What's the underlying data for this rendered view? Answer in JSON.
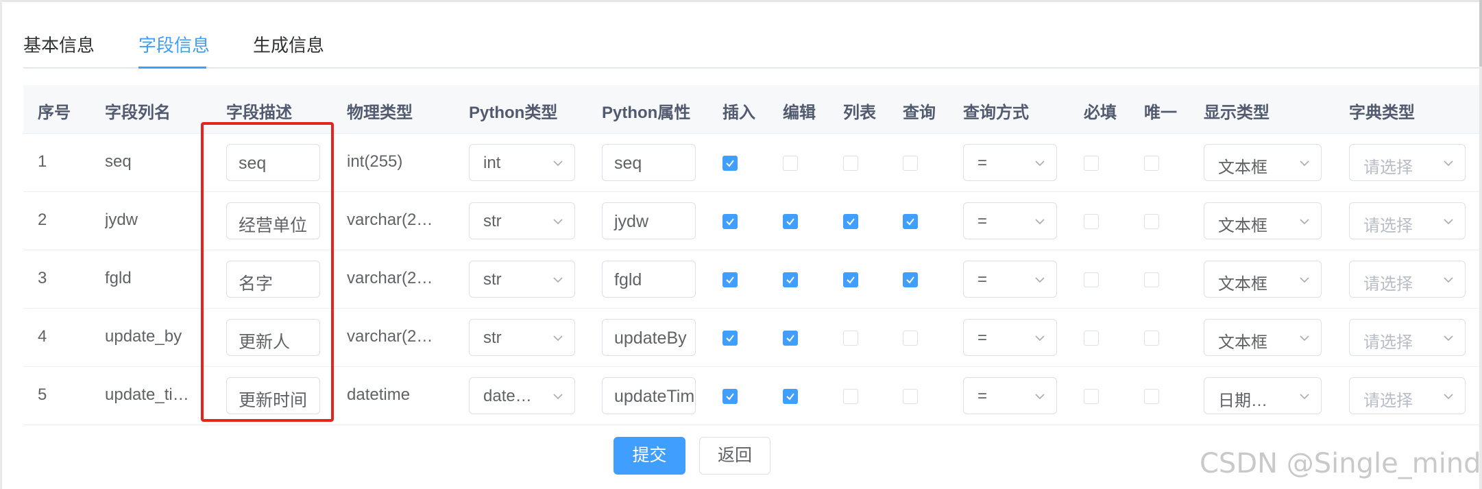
{
  "tabs": [
    {
      "label": "基本信息",
      "active": false
    },
    {
      "label": "字段信息",
      "active": true
    },
    {
      "label": "生成信息",
      "active": false
    }
  ],
  "table": {
    "columns": [
      "序号",
      "字段列名",
      "字段描述",
      "物理类型",
      "Python类型",
      "Python属性",
      "插入",
      "编辑",
      "列表",
      "查询",
      "查询方式",
      "必填",
      "唯一",
      "显示类型",
      "字典类型"
    ],
    "rows": [
      {
        "index": "1",
        "column_name": "seq",
        "description": "seq",
        "physical_type": "int(255)",
        "python_type": "int",
        "python_attr": "seq",
        "insert": true,
        "edit": false,
        "list": false,
        "query": false,
        "query_method": "=",
        "required": false,
        "unique": false,
        "display_type": "文本框",
        "dict_type": "请选择"
      },
      {
        "index": "2",
        "column_name": "jydw",
        "description": "经营单位",
        "physical_type": "varchar(2…",
        "python_type": "str",
        "python_attr": "jydw",
        "insert": true,
        "edit": true,
        "list": true,
        "query": true,
        "query_method": "=",
        "required": false,
        "unique": false,
        "display_type": "文本框",
        "dict_type": "请选择"
      },
      {
        "index": "3",
        "column_name": "fgld",
        "description": "名字",
        "physical_type": "varchar(2…",
        "python_type": "str",
        "python_attr": "fgld",
        "insert": true,
        "edit": true,
        "list": true,
        "query": true,
        "query_method": "=",
        "required": false,
        "unique": false,
        "display_type": "文本框",
        "dict_type": "请选择"
      },
      {
        "index": "4",
        "column_name": "update_by",
        "description": "更新人",
        "physical_type": "varchar(2…",
        "python_type": "str",
        "python_attr": "updateBy",
        "insert": true,
        "edit": true,
        "list": false,
        "query": false,
        "query_method": "=",
        "required": false,
        "unique": false,
        "display_type": "文本框",
        "dict_type": "请选择"
      },
      {
        "index": "5",
        "column_name": "update_ti…",
        "description": "更新时间",
        "physical_type": "datetime",
        "python_type": "date…",
        "python_attr": "updateTime",
        "insert": true,
        "edit": true,
        "list": false,
        "query": false,
        "query_method": "=",
        "required": false,
        "unique": false,
        "display_type": "日期…",
        "dict_type": "请选择"
      }
    ]
  },
  "actions": {
    "submit": "提交",
    "back": "返回"
  },
  "watermark": "CSDN @Single_minde",
  "colors": {
    "accent": "#409eff",
    "highlight": "#e3251e",
    "placeholder": "#b8bcc5"
  }
}
